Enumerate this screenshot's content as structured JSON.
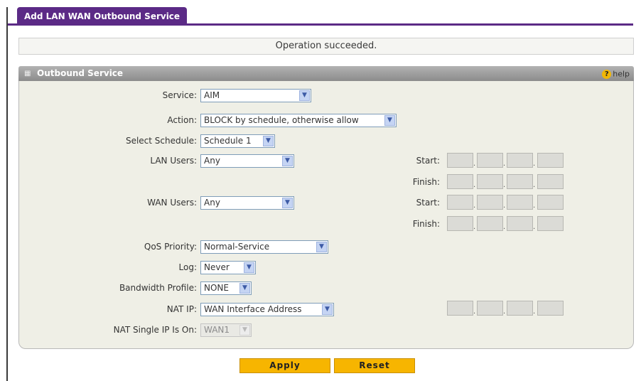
{
  "tab": {
    "label": "Add LAN WAN Outbound Service"
  },
  "status": {
    "message": "Operation succeeded."
  },
  "panel": {
    "title": "Outbound Service",
    "help_label": "help",
    "help_glyph": "?"
  },
  "form": {
    "service": {
      "label": "Service:",
      "value": "AIM"
    },
    "action": {
      "label": "Action:",
      "value": "BLOCK by schedule, otherwise allow"
    },
    "schedule": {
      "label": "Select Schedule:",
      "value": "Schedule 1"
    },
    "lan_users": {
      "label": "LAN Users:",
      "value": "Any"
    },
    "wan_users": {
      "label": "WAN Users:",
      "value": "Any"
    },
    "qos": {
      "label": "QoS Priority:",
      "value": "Normal-Service"
    },
    "log": {
      "label": "Log:",
      "value": "Never"
    },
    "bandwidth": {
      "label": "Bandwidth Profile:",
      "value": "NONE"
    },
    "nat_ip": {
      "label": "NAT IP:",
      "value": "WAN Interface Address"
    },
    "nat_single": {
      "label": "NAT Single IP Is On:",
      "value": "WAN1"
    }
  },
  "ip_labels": {
    "start": "Start:",
    "finish": "Finish:"
  },
  "buttons": {
    "apply": "Apply",
    "reset": "Reset"
  },
  "colors": {
    "tab_bg": "#5b2a86",
    "button_bg": "#f7b500",
    "panel_bg": "#efefe6",
    "header_bg": "#9e9e9e"
  },
  "icons": {
    "panel": "grid-icon",
    "help": "help-circle-icon",
    "dropdown": "chevron-down-icon"
  }
}
